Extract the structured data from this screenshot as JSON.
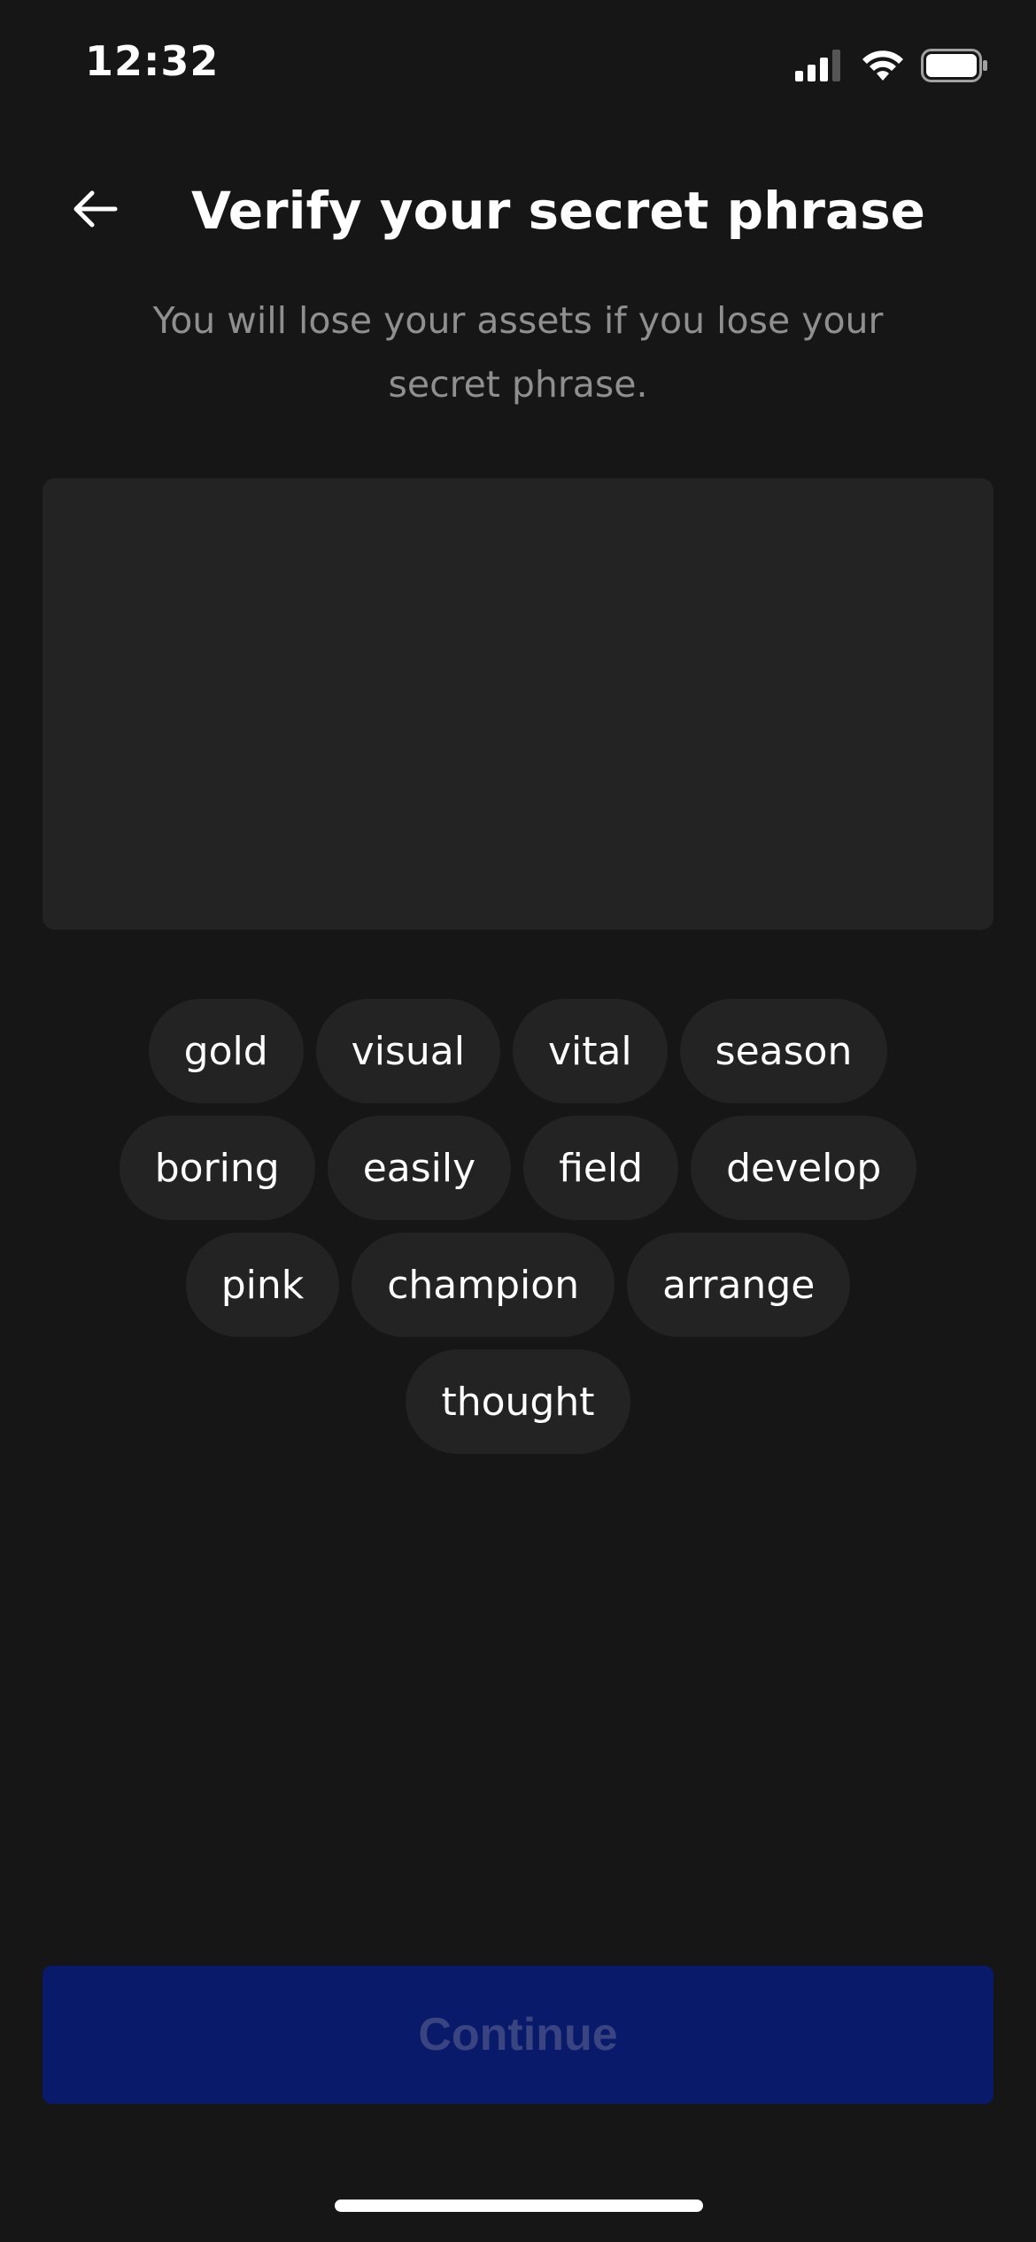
{
  "status_bar": {
    "time": "12:32",
    "icons": [
      "cellular-signal-icon",
      "wifi-icon",
      "battery-icon"
    ]
  },
  "header": {
    "back_icon": "arrow-left-icon",
    "title": "Verify your secret phrase"
  },
  "subtitle": "You will lose your assets if you lose your secret phrase.",
  "word_rows": [
    [
      "gold",
      "visual",
      "vital",
      "season"
    ],
    [
      "boring",
      "easily",
      "field",
      "develop"
    ],
    [
      "pink",
      "champion",
      "arrange"
    ],
    [
      "thought"
    ]
  ],
  "continue_button": {
    "label": "Continue",
    "state": "disabled"
  },
  "colors": {
    "background": "#161616",
    "surface": "#232323",
    "primary_disabled": "#0a1a6b",
    "primary_disabled_text": "#3a4480",
    "subtitle_text": "#8f8f8f"
  }
}
